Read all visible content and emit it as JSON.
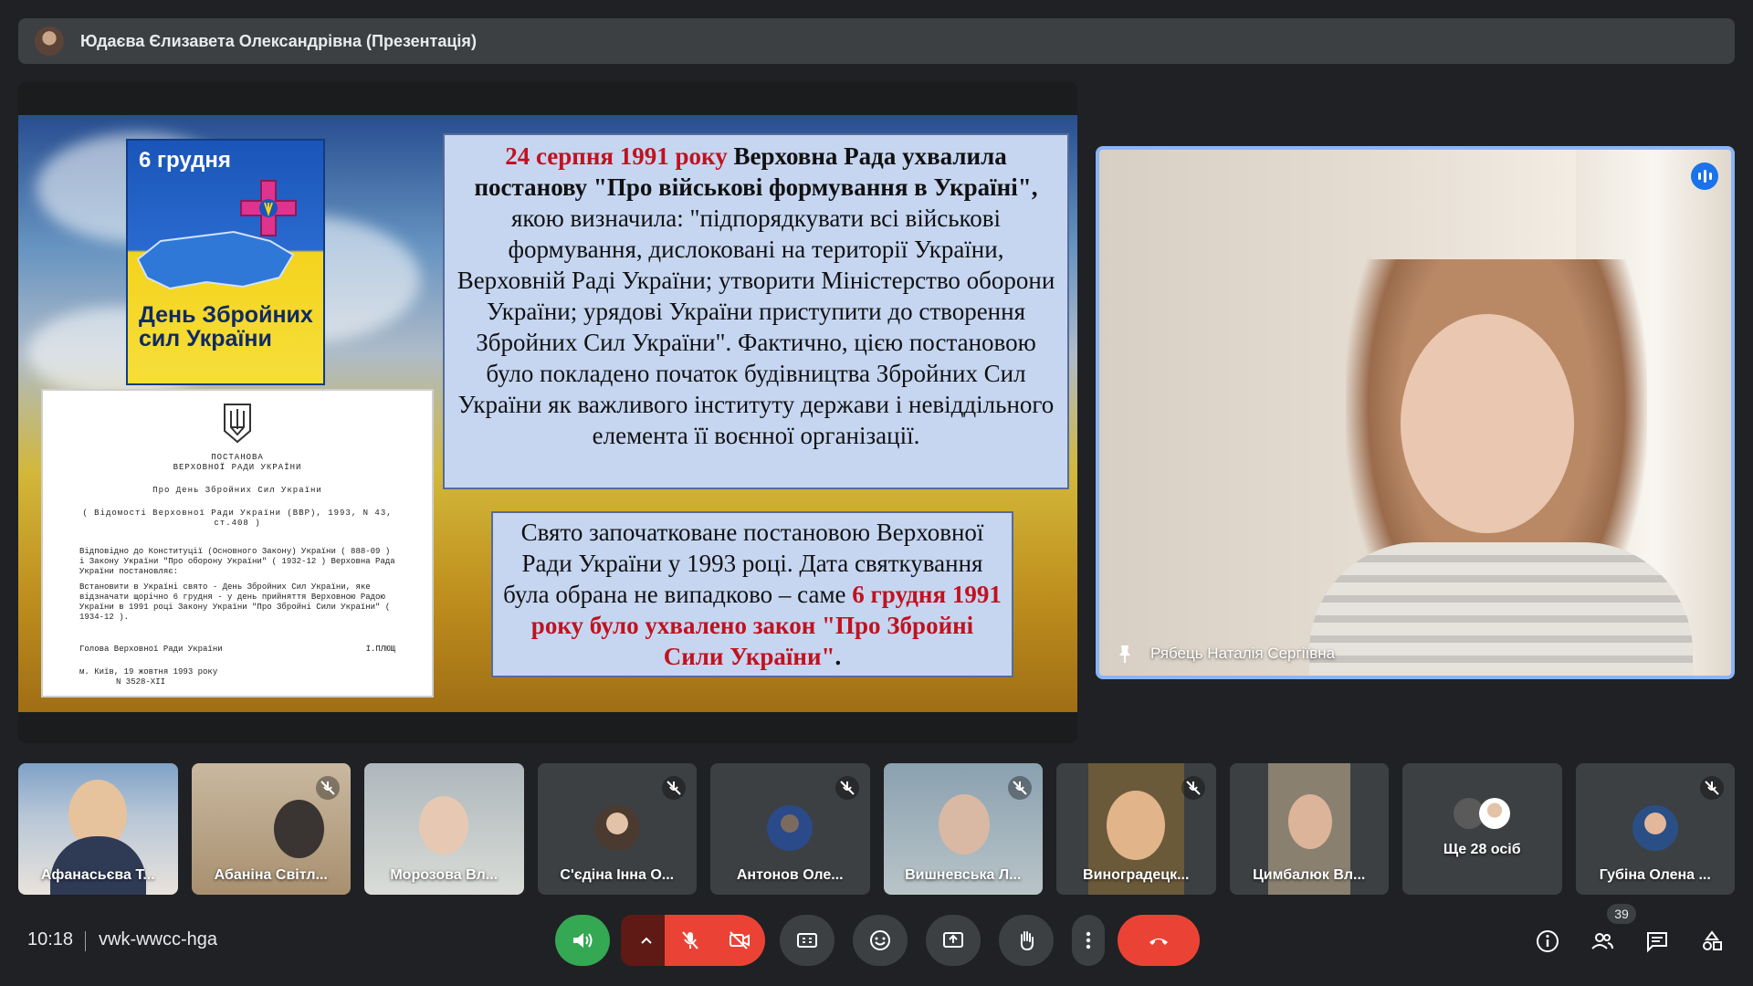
{
  "header": {
    "presenter_title": "Юдаєва Єлизавета Олександрівна (Презентація)"
  },
  "slide": {
    "poster_date": "6 грудня",
    "poster_title": "День Збройних сил України",
    "doc_title": "ПОСТАНОВА",
    "doc_subtitle": "ВЕРХОВНОЇ РАДИ УКРАЇНИ",
    "doc_name": "Про День Збройних Сил України",
    "doc_source": "( Відомості Верховної Ради України (ВВР), 1993, N 43, ст.408 )",
    "doc_p1": "Відповідно до Конституції (Основного Закону) України ( 888-09 ) і Закону України \"Про оборону України\" ( 1932-12 ) Верховна Рада України постановляє:",
    "doc_p2": "Встановити в Україні свято - День Збройних Сил України, яке відзначати щорічно 6 грудня - у день прийняття Верховною Радою України в 1991 році Закону України \"Про Збройні Сили України\" ( 1934-12 ).",
    "doc_sign_left": "Голова Верховної Ради України",
    "doc_sign_right": "І.ПЛЮЩ",
    "doc_place": "м. Київ, 19 жовтня 1993 року",
    "doc_number": "N 3528-XII",
    "box1_red": "24 серпня 1991 року",
    "box1_bold": " Верховна Рада ухвалила постанову \"Про військові формування в Україні\",",
    "box1_text": " якою визначила: \"підпорядкувати всі військові формування, дислоковані на території України, Верховній Раді України; утворити Міністерство оборони України; урядові України приступити до створення Збройних Сил України\". Фактично, цією постановою було покладено початок будівництва Збройних Сил України як важливого інституту держави і невіддільного елемента її воєнної організації.",
    "box2_text": "Свято започатковане постановою Верховної Ради України у 1993 році. Дата святкування була обрана не випадково – саме ",
    "box2_red": "6 грудня 1991 року було ухвалено закон \"Про Збройні Сили України\"",
    "box2_end": "."
  },
  "speaker": {
    "name": "Рябець Наталія Сергіївна"
  },
  "participants": [
    {
      "name": "Афанасьєва Т..."
    },
    {
      "name": "Абаніна Світл..."
    },
    {
      "name": "Морозова Вл..."
    },
    {
      "name": "С'єдіна Інна О..."
    },
    {
      "name": "Антонов Оле..."
    },
    {
      "name": "Вишневська Л..."
    },
    {
      "name": "Виноградецк..."
    },
    {
      "name": "Цимбалюк Вл..."
    },
    {
      "name": "Ще 28 осіб"
    },
    {
      "name": "Губіна Олена ..."
    }
  ],
  "bottombar": {
    "time": "10:18",
    "meeting_code": "vwk-wwcc-hga",
    "people_count": "39"
  },
  "colors": {
    "accent": "#8ab4f8",
    "end_call": "#ea4335",
    "audio_on": "#34a853",
    "muted": "#f28b82"
  }
}
